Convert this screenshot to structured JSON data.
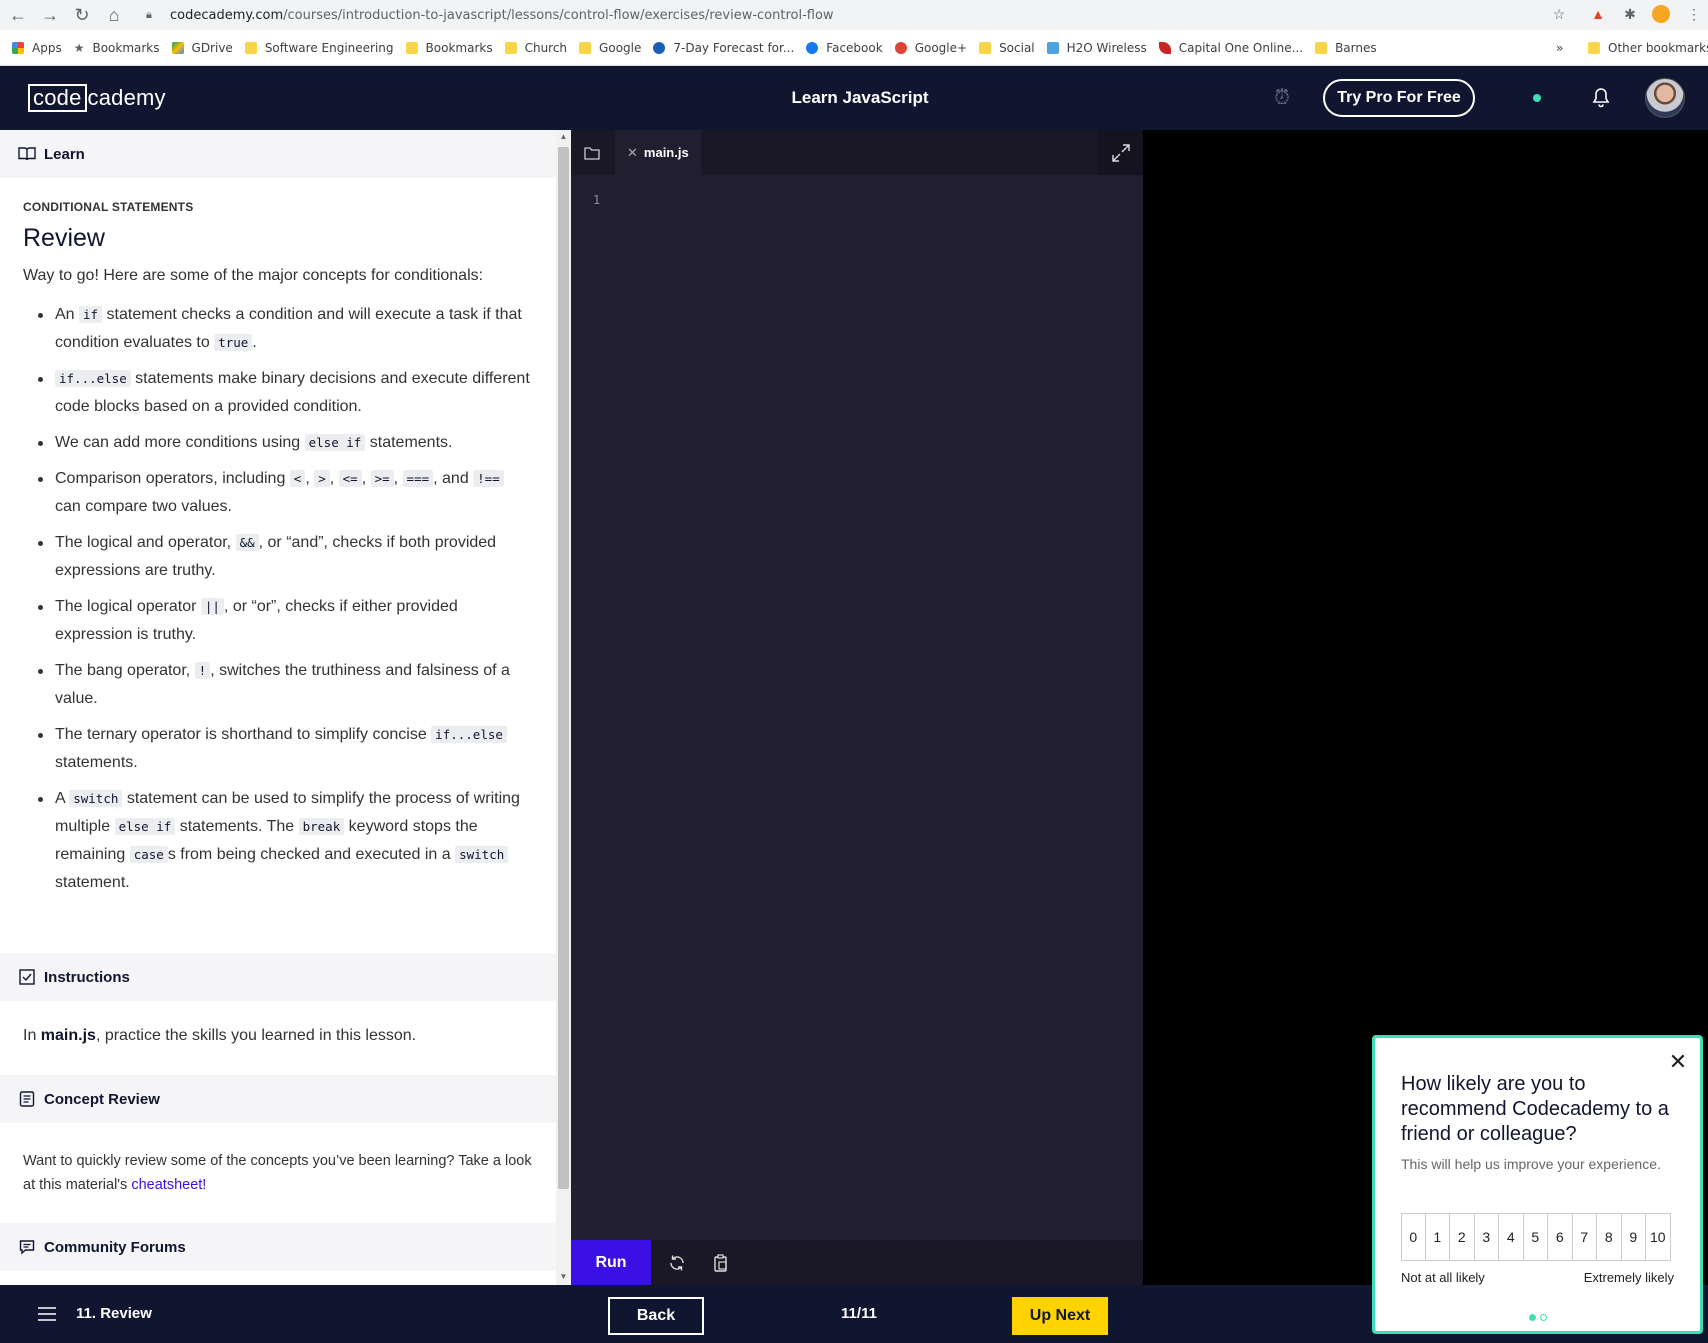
{
  "browser": {
    "url_domain": "codecademy.com",
    "url_path": "/courses/introduction-to-javascript/lessons/control-flow/exercises/review-control-flow",
    "bookmarks": [
      {
        "label": "Apps",
        "icon": "apps-grid-icon"
      },
      {
        "label": "Bookmarks",
        "icon": "star-icon"
      },
      {
        "label": "GDrive",
        "icon": "google-drive-icon"
      },
      {
        "label": "Software Engineering",
        "icon": "folder-icon"
      },
      {
        "label": "Bookmarks",
        "icon": "folder-icon"
      },
      {
        "label": "Church",
        "icon": "folder-icon"
      },
      {
        "label": "Google",
        "icon": "folder-icon"
      },
      {
        "label": "7-Day Forecast for...",
        "icon": "noaa-icon"
      },
      {
        "label": "Facebook",
        "icon": "facebook-icon"
      },
      {
        "label": "Google+",
        "icon": "google-plus-icon"
      },
      {
        "label": "Social",
        "icon": "folder-icon"
      },
      {
        "label": "H2O Wireless",
        "icon": "h2o-icon"
      },
      {
        "label": "Capital One Online...",
        "icon": "capital-one-icon"
      },
      {
        "label": "Barnes",
        "icon": "folder-icon"
      }
    ],
    "overflow": "»",
    "other_bookmarks": "Other bookmarks"
  },
  "header": {
    "logo_box": "code",
    "logo_rest": "cademy",
    "course_title": "Learn JavaScript",
    "try_pro": "Try Pro For Free"
  },
  "learn": {
    "section_label": "Learn",
    "eyebrow": "CONDITIONAL STATEMENTS",
    "title": "Review",
    "intro": "Way to go! Here are some of the major concepts for conditionals:"
  },
  "instructions": {
    "section_label": "Instructions",
    "prefix": "In ",
    "file": "main.js",
    "suffix": ", practice the skills you learned in this lesson."
  },
  "concept_review": {
    "section_label": "Concept Review",
    "text": "Want to quickly review some of the concepts you’ve been learning? Take a look at this material's ",
    "link": "cheatsheet!"
  },
  "community": {
    "section_label": "Community Forums"
  },
  "editor": {
    "tab_name": "main.js",
    "line_numbers": [
      "1"
    ],
    "run_label": "Run"
  },
  "footer": {
    "lesson": "11. Review",
    "back": "Back",
    "progress": "11/11",
    "next": "Up Next"
  },
  "survey": {
    "question": "How likely are you to recommend Codecademy to a friend or colleague?",
    "subtext": "This will help us improve your experience.",
    "scale": [
      "0",
      "1",
      "2",
      "3",
      "4",
      "5",
      "6",
      "7",
      "8",
      "9",
      "10"
    ],
    "low_label": "Not at all likely",
    "high_label": "Extremely likely"
  },
  "colors": {
    "navy": "#10162f",
    "accent": "#3a10e5",
    "yellow": "#ffd300",
    "mint": "#3fdfb5",
    "editor_bg": "#211e2f"
  }
}
